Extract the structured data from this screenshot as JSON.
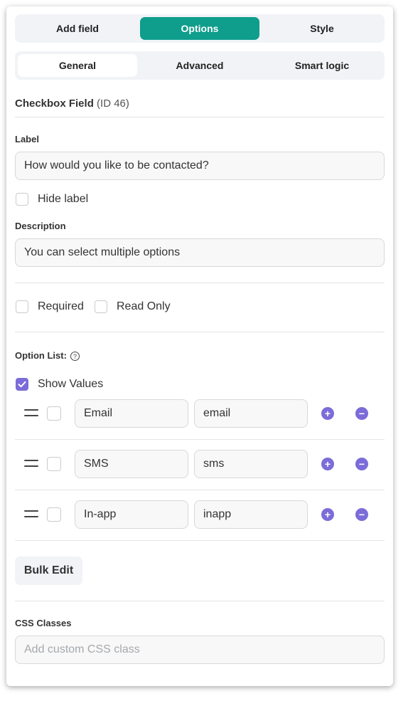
{
  "tabs": [
    {
      "label": "Add field",
      "active": false
    },
    {
      "label": "Options",
      "active": true
    },
    {
      "label": "Style",
      "active": false
    }
  ],
  "subtabs": [
    {
      "label": "General",
      "active": true
    },
    {
      "label": "Advanced",
      "active": false
    },
    {
      "label": "Smart logic",
      "active": false
    }
  ],
  "field": {
    "type": "Checkbox Field",
    "id": "(ID 46)"
  },
  "label": {
    "title": "Label",
    "value": "How would you like to be contacted?"
  },
  "hide_label": {
    "text": "Hide label",
    "checked": false
  },
  "description": {
    "title": "Description",
    "value": "You can select multiple options"
  },
  "required": {
    "text": "Required",
    "checked": false
  },
  "read_only": {
    "text": "Read Only",
    "checked": false
  },
  "option_list": {
    "title": "Option List:",
    "help_icon": "question-circle-icon",
    "show_values": {
      "text": "Show Values",
      "checked": true
    },
    "options": [
      {
        "label": "Email",
        "value": "email",
        "checked": false
      },
      {
        "label": "SMS",
        "value": "sms",
        "checked": false
      },
      {
        "label": "In-app",
        "value": "inapp",
        "checked": false
      }
    ]
  },
  "bulk_edit": "Bulk Edit",
  "css_classes": {
    "title": "CSS Classes",
    "value": "",
    "placeholder": "Add custom CSS class"
  },
  "colors": {
    "accent_teal": "#0f9d8c",
    "accent_purple": "#7b6cd9"
  }
}
